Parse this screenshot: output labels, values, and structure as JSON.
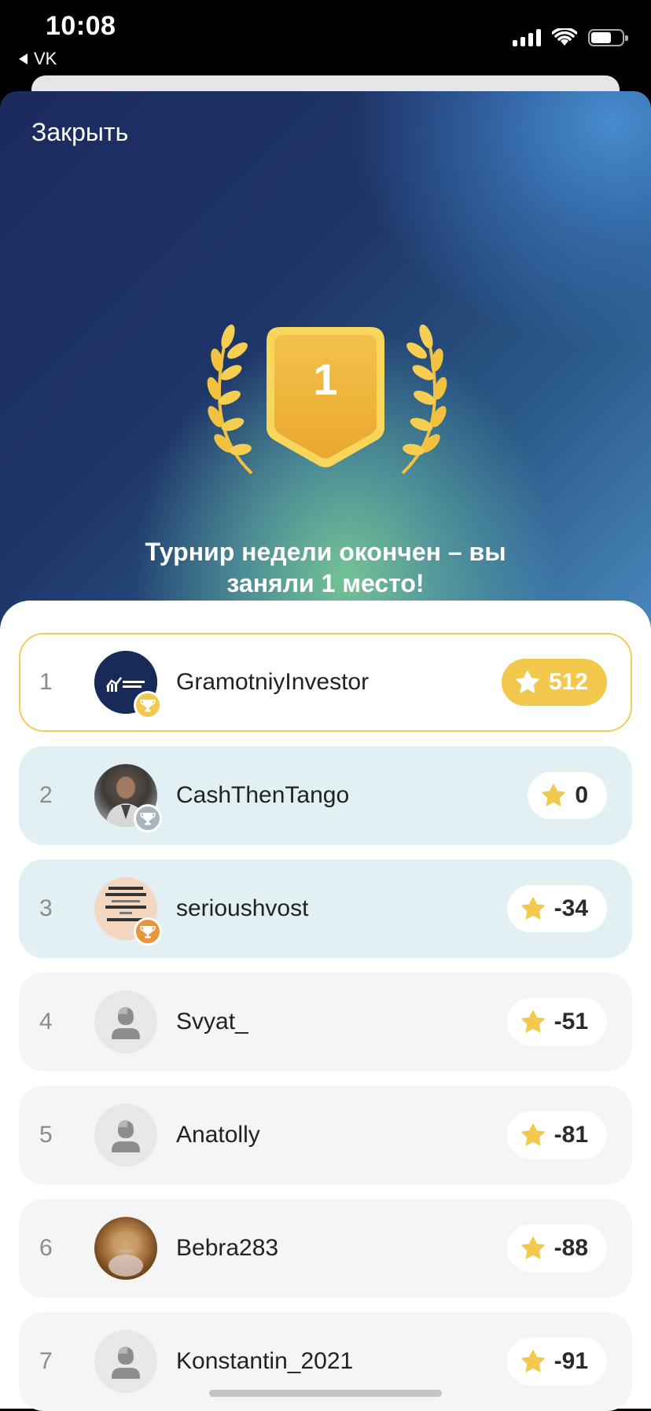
{
  "status": {
    "time": "10:08",
    "back_app": "VK"
  },
  "hero": {
    "close_label": "Закрыть",
    "place_badge": "1",
    "title_line1": "Турнир недели окончен – вы",
    "title_line2": "заняли 1 место!"
  },
  "colors": {
    "gold": "#f2c94c",
    "silver": "#a9b4bf",
    "bronze": "#e8963c",
    "row_top3": "#e3f0f3",
    "row_other": "#f5f5f6"
  },
  "leaderboard": [
    {
      "rank": "1",
      "name": "GramotniyInvestor",
      "score": "512",
      "avatar": "gramotniy-investor-logo",
      "medal": "gold"
    },
    {
      "rank": "2",
      "name": "CashThenTango",
      "score": "0",
      "avatar": "photo",
      "medal": "silver"
    },
    {
      "rank": "3",
      "name": "serioushvost",
      "score": "-34",
      "avatar": "text-image",
      "medal": "bronze"
    },
    {
      "rank": "4",
      "name": "Svyat_",
      "score": "-51",
      "avatar": "placeholder",
      "medal": ""
    },
    {
      "rank": "5",
      "name": "Anatolly",
      "score": "-81",
      "avatar": "placeholder",
      "medal": ""
    },
    {
      "rank": "6",
      "name": "Bebra283",
      "score": "-88",
      "avatar": "photo",
      "medal": ""
    },
    {
      "rank": "7",
      "name": "Konstantin_2021",
      "score": "-91",
      "avatar": "placeholder",
      "medal": ""
    }
  ]
}
